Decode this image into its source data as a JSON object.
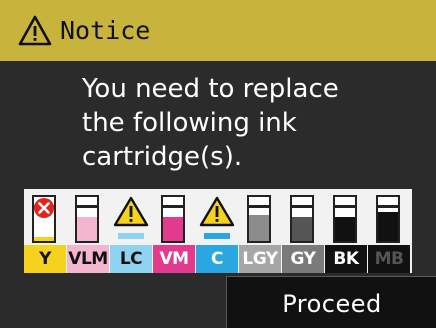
{
  "title": {
    "text": "Notice",
    "icon": "warning-triangle-icon",
    "background": "#c8b43c"
  },
  "message": {
    "lines": [
      "You need to replace",
      "the following ink",
      "cartridge(s)."
    ]
  },
  "inks": [
    {
      "label": "Y",
      "status": "error",
      "color": "#f5d21e",
      "label_bg": "#f5d21e",
      "label_fg": "#111111",
      "level": 0.08
    },
    {
      "label": "VLM",
      "status": "ok",
      "color": "#f4b6cf",
      "label_bg": "#f4b6cf",
      "label_fg": "#111111",
      "level": 0.55
    },
    {
      "label": "LC",
      "status": "warning",
      "color": "#8fd3f0",
      "label_bg": "#8fd3f0",
      "label_fg": "#111111",
      "level": 0.12
    },
    {
      "label": "VM",
      "status": "ok",
      "color": "#e23a8c",
      "label_bg": "#e23a8c",
      "label_fg": "#ffffff",
      "level": 0.55
    },
    {
      "label": "C",
      "status": "warning",
      "color": "#2aa6e0",
      "label_bg": "#2aa6e0",
      "label_fg": "#ffffff",
      "level": 0.12
    },
    {
      "label": "LGY",
      "status": "ok",
      "color": "#8c8c8c",
      "label_bg": "#a6a6a6",
      "label_fg": "#ffffff",
      "level": 0.6
    },
    {
      "label": "GY",
      "status": "ok",
      "color": "#555555",
      "label_bg": "#7a7a7a",
      "label_fg": "#ffffff",
      "level": 0.55
    },
    {
      "label": "BK",
      "status": "ok",
      "color": "#111111",
      "label_bg": "#111111",
      "label_fg": "#ffffff",
      "level": 0.55
    },
    {
      "label": "MB",
      "status": "ok",
      "color": "#111111",
      "label_bg": "#111111",
      "label_fg": "#555555",
      "level": 0.65
    }
  ],
  "proceed_button": {
    "label": "Proceed"
  }
}
